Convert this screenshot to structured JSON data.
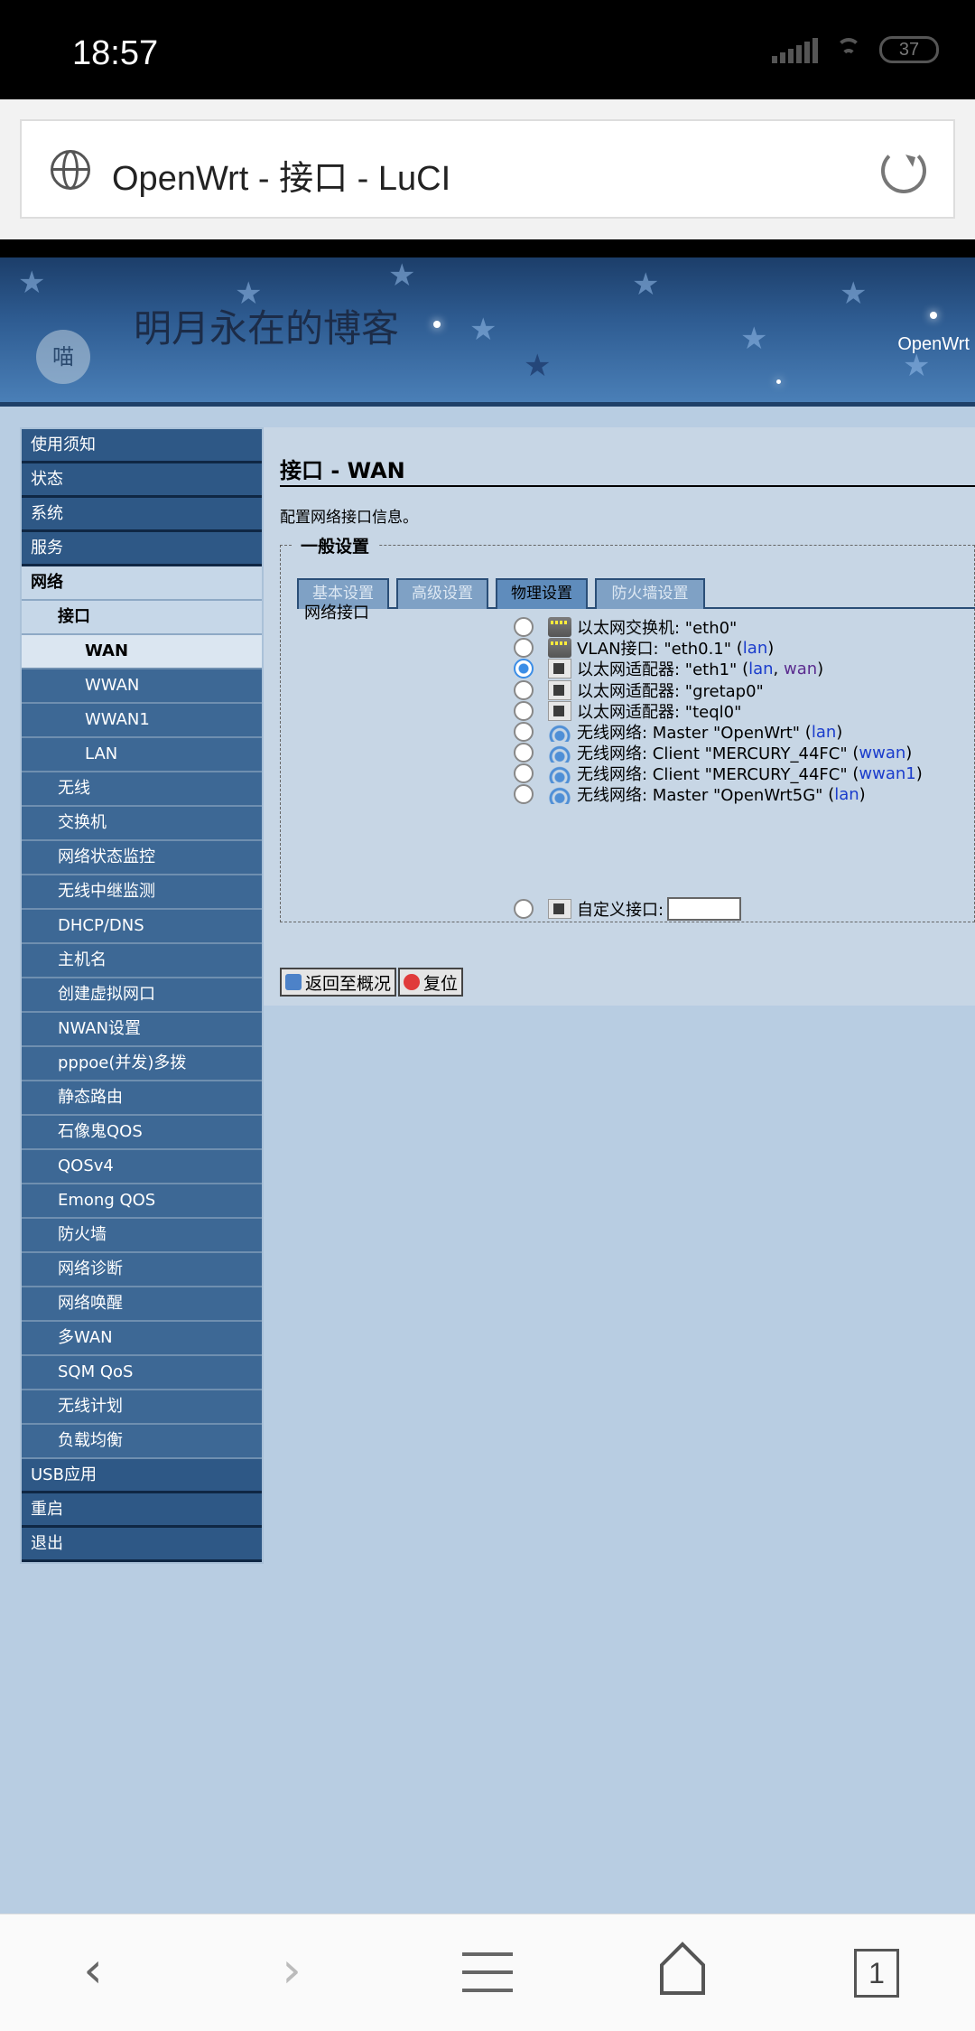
{
  "status_bar": {
    "time": "18:57",
    "battery": "37"
  },
  "browser": {
    "page_title": "OpenWrt - 接口 - LuCI"
  },
  "header": {
    "blog_title": "明月永在的博客",
    "brand": "OpenWrt",
    "cat_text": "喵"
  },
  "sidebar": {
    "items": [
      {
        "label": "使用须知",
        "level": 1
      },
      {
        "label": "状态",
        "level": 1
      },
      {
        "label": "系统",
        "level": 1
      },
      {
        "label": "服务",
        "level": 1
      },
      {
        "label": "网络",
        "level": 1
      },
      {
        "label": "接口",
        "level": 2
      },
      {
        "label": "WAN",
        "level": 3
      },
      {
        "label": "WWAN",
        "level": 3
      },
      {
        "label": "WWAN1",
        "level": 3
      },
      {
        "label": "LAN",
        "level": 3
      },
      {
        "label": "无线",
        "level": 2
      },
      {
        "label": "交换机",
        "level": 2
      },
      {
        "label": "网络状态监控",
        "level": 2
      },
      {
        "label": "无线中继监测",
        "level": 2
      },
      {
        "label": "DHCP/DNS",
        "level": 2
      },
      {
        "label": "主机名",
        "level": 2
      },
      {
        "label": "创建虚拟网口",
        "level": 2
      },
      {
        "label": "NWAN设置",
        "level": 2
      },
      {
        "label": "pppoe(并发)多拨",
        "level": 2
      },
      {
        "label": "静态路由",
        "level": 2
      },
      {
        "label": "石像鬼QOS",
        "level": 2
      },
      {
        "label": "QOSv4",
        "level": 2
      },
      {
        "label": "Emong QOS",
        "level": 2
      },
      {
        "label": "防火墙",
        "level": 2
      },
      {
        "label": "网络诊断",
        "level": 2
      },
      {
        "label": "网络唤醒",
        "level": 2
      },
      {
        "label": "多WAN",
        "level": 2
      },
      {
        "label": "SQM QoS",
        "level": 2
      },
      {
        "label": "无线计划",
        "level": 2
      },
      {
        "label": "负载均衡",
        "level": 2
      },
      {
        "label": "USB应用",
        "level": 1
      },
      {
        "label": "重启",
        "level": 1
      },
      {
        "label": "退出",
        "level": 1
      }
    ]
  },
  "main": {
    "title": "接口 - WAN",
    "description": "配置网络接口信息。",
    "section_legend": "一般设置",
    "tabs": [
      "基本设置",
      "高级设置",
      "物理设置",
      "防火墙设置"
    ],
    "active_tab": "物理设置",
    "field_label": "网络接口",
    "options": [
      {
        "icon": "switch",
        "text": "以太网交换机: \"eth0\"",
        "nets": []
      },
      {
        "icon": "switch",
        "text": "VLAN接口: \"eth0.1\"",
        "nets": [
          "lan"
        ]
      },
      {
        "icon": "eth",
        "text": "以太网适配器: \"eth1\"",
        "nets": [
          "lan",
          "wan"
        ],
        "checked": true
      },
      {
        "icon": "eth",
        "text": "以太网适配器: \"gretap0\"",
        "nets": []
      },
      {
        "icon": "eth",
        "text": "以太网适配器: \"teql0\"",
        "nets": []
      },
      {
        "icon": "wifi",
        "text": "无线网络: Master \"OpenWrt\"",
        "nets": [
          "lan"
        ]
      },
      {
        "icon": "wifi",
        "text": "无线网络: Client \"MERCURY_44FC\"",
        "nets": [
          "wwan"
        ]
      },
      {
        "icon": "wifi",
        "text": "无线网络: Client \"MERCURY_44FC\"",
        "nets": [
          "wwan1"
        ]
      },
      {
        "icon": "wifi",
        "text": "无线网络: Master \"OpenWrt5G\"",
        "nets": [
          "lan"
        ]
      }
    ],
    "custom_label": "自定义接口:",
    "custom_value": "",
    "back_button": "返回至概况",
    "reset_button": "复位"
  },
  "bottom_nav": {
    "tabs_count": "1"
  }
}
